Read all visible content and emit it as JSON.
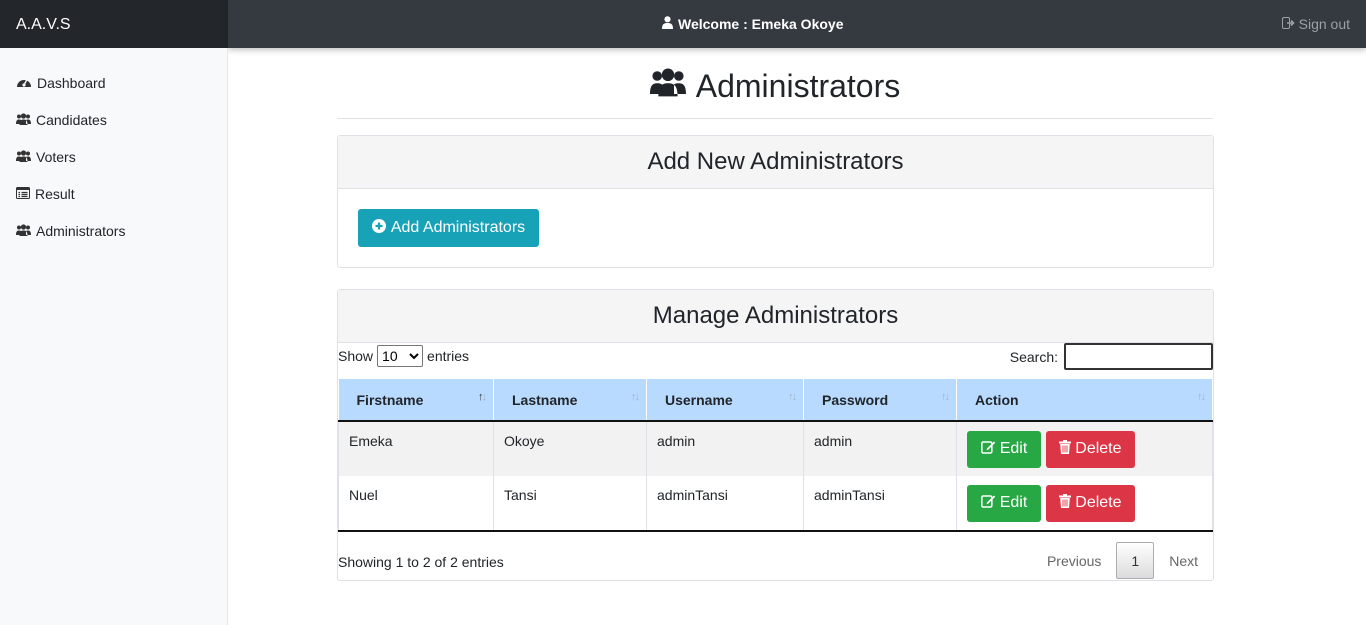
{
  "app": {
    "brand": "A.A.V.S"
  },
  "header": {
    "welcome": "Welcome : Emeka Okoye",
    "signout": "Sign out"
  },
  "sidebar": {
    "items": [
      {
        "label": "Dashboard",
        "icon": "dashboard-icon"
      },
      {
        "label": "Candidates",
        "icon": "users-icon"
      },
      {
        "label": "Voters",
        "icon": "users-icon"
      },
      {
        "label": "Result",
        "icon": "list-icon"
      },
      {
        "label": "Administrators",
        "icon": "users-icon"
      }
    ]
  },
  "page": {
    "title": "Administrators"
  },
  "add_card": {
    "title": "Add New Administrators",
    "button": "Add Administrators"
  },
  "manage_card": {
    "title": "Manage Administrators",
    "show_label": "Show",
    "entries_label": "entries",
    "page_length": "10",
    "search_label": "Search:",
    "search_value": "",
    "columns": [
      "Firstname",
      "Lastname",
      "Username",
      "Password",
      "Action"
    ],
    "rows": [
      {
        "firstname": "Emeka",
        "lastname": "Okoye",
        "username": "admin",
        "password": "admin"
      },
      {
        "firstname": "Nuel",
        "lastname": "Tansi",
        "username": "adminTansi",
        "password": "adminTansi"
      }
    ],
    "edit_label": "Edit",
    "delete_label": "Delete",
    "info": "Showing 1 to 2 of 2 entries",
    "pager": {
      "previous": "Previous",
      "current": "1",
      "next": "Next"
    }
  },
  "colors": {
    "topbar": "#343a40",
    "brand_bg": "#23272b",
    "info": "#17a2b8",
    "success": "#28a745",
    "danger": "#dc3545",
    "table_head": "#b8daff"
  }
}
